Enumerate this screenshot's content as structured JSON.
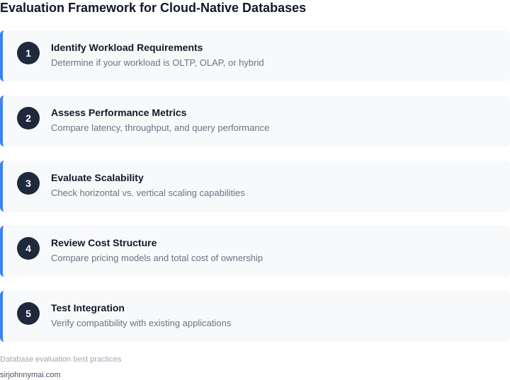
{
  "title": "Evaluation Framework for Cloud-Native Databases",
  "steps": [
    {
      "number": "1",
      "title": "Identify Workload Requirements",
      "description": "Determine if your workload is OLTP, OLAP, or hybrid"
    },
    {
      "number": "2",
      "title": "Assess Performance Metrics",
      "description": "Compare latency, throughput, and query performance"
    },
    {
      "number": "3",
      "title": "Evaluate Scalability",
      "description": "Check horizontal vs. vertical scaling capabilities"
    },
    {
      "number": "4",
      "title": "Review Cost Structure",
      "description": "Compare pricing models and total cost of ownership"
    },
    {
      "number": "5",
      "title": "Test Integration",
      "description": "Verify compatibility with existing applications"
    }
  ],
  "footer": {
    "note": "Database evaluation best practices",
    "source": "sirjohnnymai.com"
  },
  "colors": {
    "accent": "#3b82f6",
    "badge": "#1e293b",
    "card_background": "#f8f9fb"
  }
}
